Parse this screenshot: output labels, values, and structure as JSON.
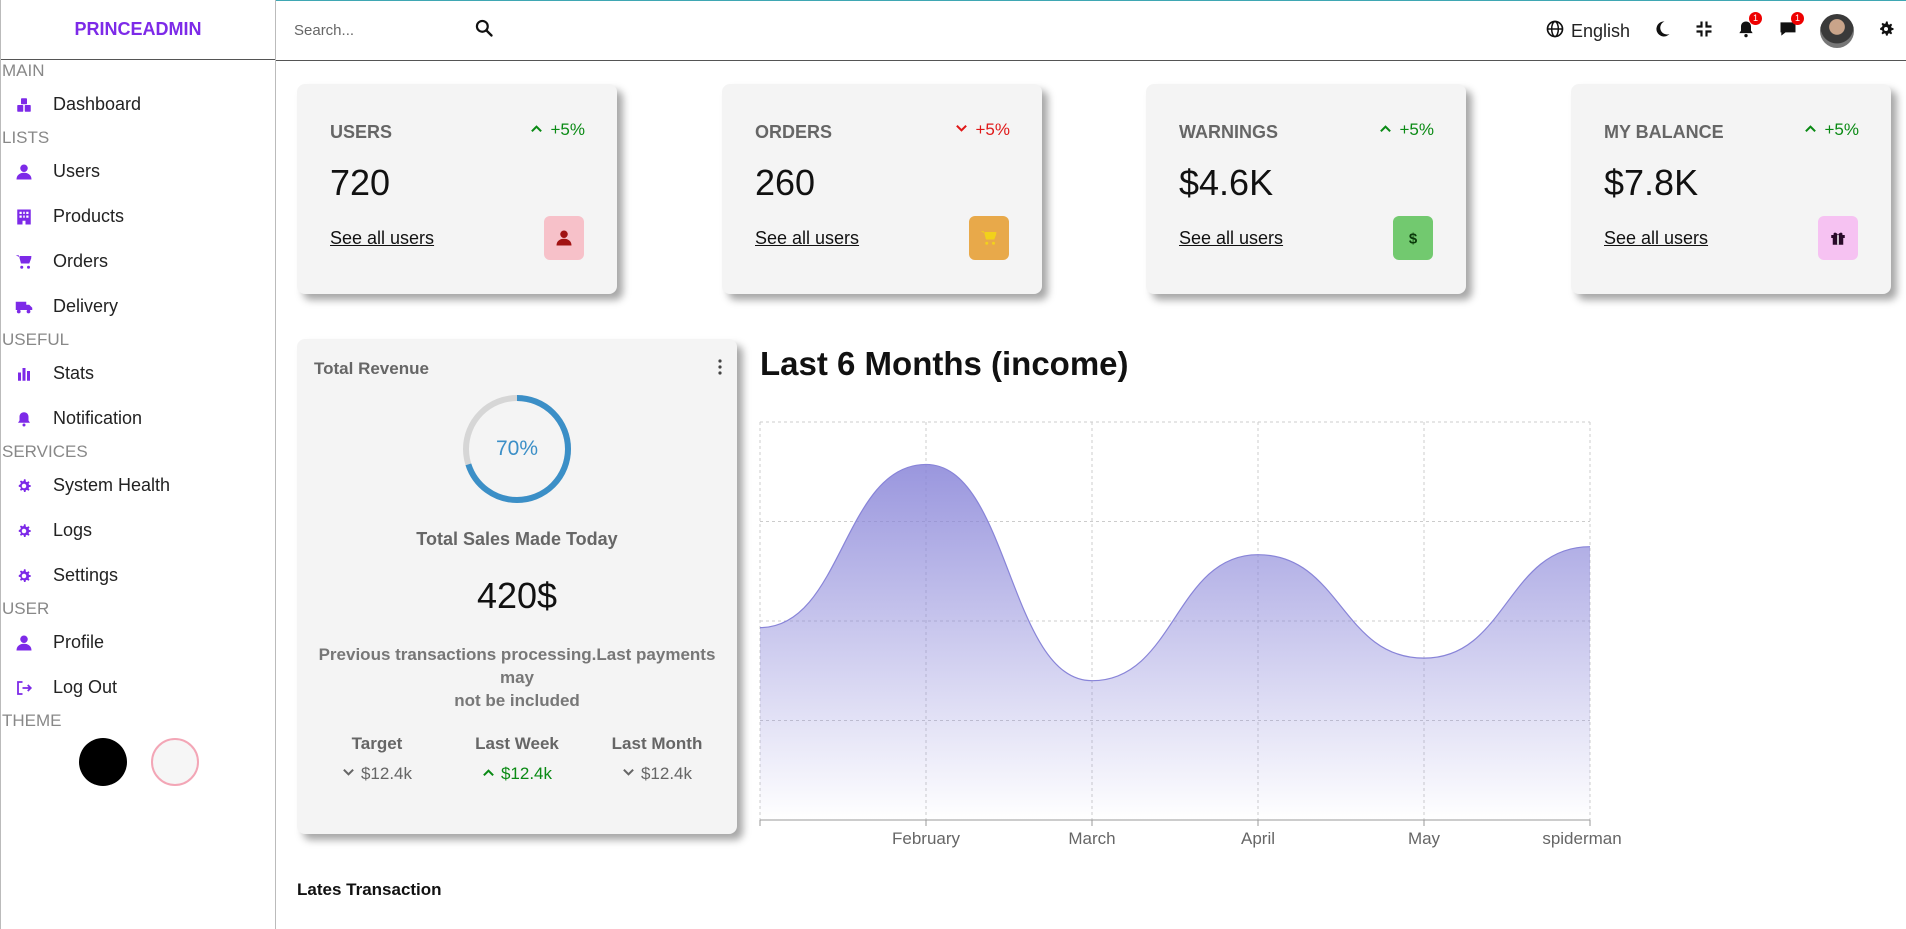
{
  "brand": "PRINCEADMIN",
  "sidebar": {
    "sections": [
      {
        "title": "MAIN",
        "items": [
          {
            "label": "Dashboard",
            "icon": "dashboard-icon"
          }
        ]
      },
      {
        "title": "LISTS",
        "items": [
          {
            "label": "Users",
            "icon": "person-icon"
          },
          {
            "label": "Products",
            "icon": "store-icon"
          },
          {
            "label": "Orders",
            "icon": "cart-icon"
          },
          {
            "label": "Delivery",
            "icon": "truck-icon"
          }
        ]
      },
      {
        "title": "USEFUL",
        "items": [
          {
            "label": "Stats",
            "icon": "bar-chart-icon"
          },
          {
            "label": "Notification",
            "icon": "bell-icon"
          }
        ]
      },
      {
        "title": "SERVICES",
        "items": [
          {
            "label": "System Health",
            "icon": "gear-icon"
          },
          {
            "label": "Logs",
            "icon": "gear-icon"
          },
          {
            "label": "Settings",
            "icon": "gear-icon"
          }
        ]
      },
      {
        "title": "USER",
        "items": [
          {
            "label": "Profile",
            "icon": "person-icon"
          },
          {
            "label": "Log Out",
            "icon": "logout-icon"
          }
        ]
      }
    ],
    "theme_title": "THEME",
    "accent": "#7d2ae8"
  },
  "navbar": {
    "search_placeholder": "Search...",
    "language": "English",
    "notifications_count": "1",
    "messages_count": "1"
  },
  "widgets": [
    {
      "title": "USERS",
      "pct": "+5%",
      "trend": "up",
      "value": "720",
      "link": "See all users",
      "icon": "person-icon",
      "icon_bg": "#f7c1c9",
      "icon_color": "#a11313"
    },
    {
      "title": "ORDERS",
      "pct": "+5%",
      "trend": "down",
      "value": "260",
      "link": "See all users",
      "icon": "cart-icon",
      "icon_bg": "#e8a94a",
      "icon_color": "#f2d11b"
    },
    {
      "title": "WARNINGS",
      "pct": "+5%",
      "trend": "up",
      "value": "$4.6K",
      "link": "See all users",
      "icon": "dollar-icon",
      "icon_bg": "#72c96f",
      "icon_color": "#0a3a0a"
    },
    {
      "title": "MY BALANCE",
      "pct": "+5%",
      "trend": "up",
      "value": "$7.8K",
      "link": "See all users",
      "icon": "gift-icon",
      "icon_bg": "#f6c2f2",
      "icon_color": "#2a0a2a"
    }
  ],
  "revenue": {
    "title": "Total Revenue",
    "progress": 70,
    "progress_label": "70%",
    "subtitle": "Total Sales Made Today",
    "amount": "420$",
    "note_line1": "Previous transactions processing.Last payments may",
    "note_line2": "not be included",
    "stats": [
      {
        "label": "Target",
        "value": "$12.4k",
        "trend": "down"
      },
      {
        "label": "Last Week",
        "value": "$12.4k",
        "trend": "up"
      },
      {
        "label": "Last Month",
        "value": "$12.4k",
        "trend": "down"
      }
    ]
  },
  "chart_data": {
    "type": "area",
    "title": "Last 6 Months (income)",
    "x": [
      "",
      "February",
      "March",
      "April",
      "May",
      "spiderman"
    ],
    "values": [
      1450,
      2680,
      1050,
      2000,
      1220,
      2060
    ],
    "ylim": [
      0,
      3000
    ],
    "grid": true,
    "color": "#8884d8"
  },
  "transactions_title": "Lates Transaction"
}
